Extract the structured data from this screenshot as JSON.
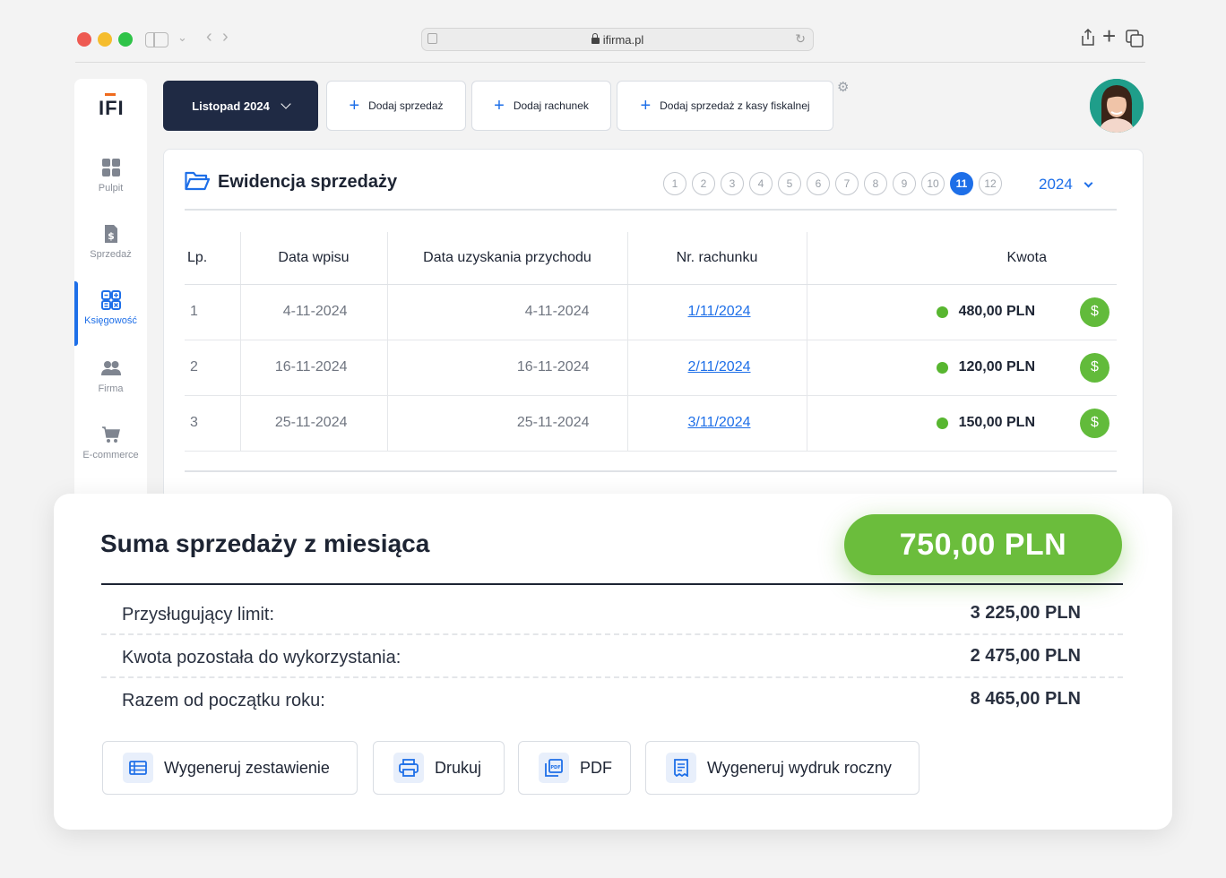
{
  "browser": {
    "url": "ifirma.pl"
  },
  "sidebar": {
    "logo": "IFI",
    "items": [
      {
        "label": "Pulpit",
        "icon": "dashboard-icon"
      },
      {
        "label": "Sprzedaż",
        "icon": "invoice-icon"
      },
      {
        "label": "Księgowość",
        "icon": "accounting-icon",
        "active": true
      },
      {
        "label": "Firma",
        "icon": "users-icon"
      },
      {
        "label": "E-commerce",
        "icon": "cart-icon"
      }
    ]
  },
  "toolbar": {
    "month": "Listopad 2024",
    "actions": [
      "Dodaj sprzedaż",
      "Dodaj rachunek",
      "Dodaj sprzedaż z kasy fiskalnej"
    ]
  },
  "ledger": {
    "title": "Ewidencja sprzedaży",
    "pages": [
      "1",
      "2",
      "3",
      "4",
      "5",
      "6",
      "7",
      "8",
      "9",
      "10",
      "11",
      "12"
    ],
    "current_page": "11",
    "year": "2024",
    "columns": [
      "Lp.",
      "Data wpisu",
      "Data uzyskania przychodu",
      "Nr. rachunku",
      "Kwota"
    ],
    "rows": [
      {
        "lp": "1",
        "data_wpisu": "4-11-2024",
        "data_przychodu": "4-11-2024",
        "nr": "1/11/2024",
        "kwota": "480,00 PLN",
        "pay": "$"
      },
      {
        "lp": "2",
        "data_wpisu": "16-11-2024",
        "data_przychodu": "16-11-2024",
        "nr": "2/11/2024",
        "kwota": "120,00 PLN",
        "pay": "$"
      },
      {
        "lp": "3",
        "data_wpisu": "25-11-2024",
        "data_przychodu": "25-11-2024",
        "nr": "3/11/2024",
        "kwota": "150,00 PLN",
        "pay": "$"
      }
    ]
  },
  "summary": {
    "title": "Suma sprzedaży z miesiąca",
    "total": "750,00 PLN",
    "rows": [
      {
        "label": "Przysługujący limit:",
        "value": "3 225,00 PLN"
      },
      {
        "label": "Kwota pozostała do wykorzystania:",
        "value": "2 475,00 PLN"
      },
      {
        "label": "Razem od początku roku:",
        "value": "8 465,00 PLN"
      }
    ],
    "buttons": [
      "Wygeneruj zestawienie",
      "Drukuj",
      "PDF",
      "Wygeneruj wydruk roczny"
    ]
  },
  "colors": {
    "accent": "#1e6fe8",
    "brand_dark": "#1f2a44",
    "success": "#6bbd3c",
    "logo_orange": "#ef6b1e"
  }
}
